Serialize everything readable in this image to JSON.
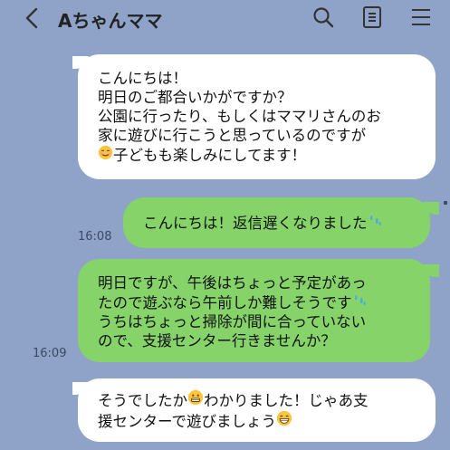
{
  "header": {
    "title": "Aちゃんママ"
  },
  "messages": [
    {
      "direction": "incoming",
      "lines": [
        "こんにちは！",
        "明日のご都合いかがですか？",
        "公園に行ったり、もしくはママリさんのお",
        "家に遊びに行こうと思っているのですが",
        "子どもも楽しみにしてます！"
      ],
      "time": ""
    },
    {
      "direction": "outgoing",
      "lines": [
        "こんにちは！返信遅くなりました"
      ],
      "time": "16:08"
    },
    {
      "direction": "outgoing",
      "lines": [
        "明日ですが、午後はちょっと予定があっ",
        "たので遊ぶなら午前しか難しそうです",
        "うちはちょっと掃除が間に合っていない",
        "ので、支援センター行きませんか？"
      ],
      "time": "16:09"
    },
    {
      "direction": "incoming",
      "lines": [
        "そうでしたか",
        "わかりました！じゃあ支",
        "援センターで遊びましょう"
      ],
      "time": ""
    }
  ],
  "colors": {
    "background": "#8fa3c8",
    "incoming_bubble": "#ffffff",
    "outgoing_bubble": "#86d36a"
  },
  "icons": [
    "back-chevron-icon",
    "search-icon",
    "notes-icon",
    "menu-icon",
    "smile-emoji-icon",
    "sweat-emoji-icon",
    "grin-emoji-icon"
  ]
}
